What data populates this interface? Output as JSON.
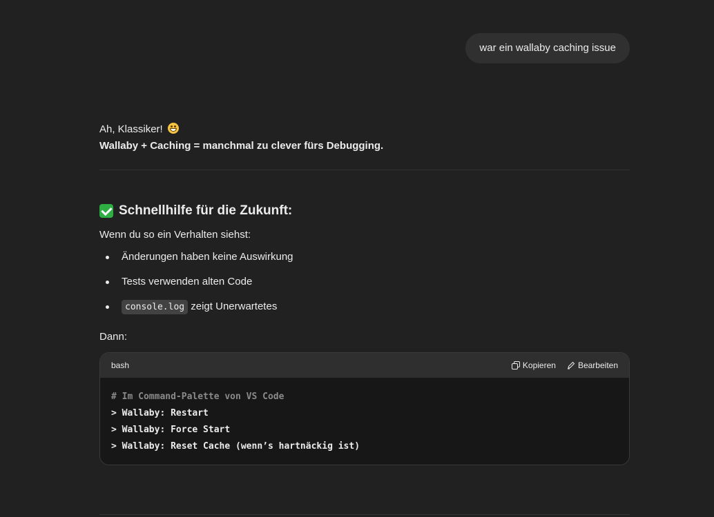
{
  "user_message": "war ein wallaby caching issue",
  "assistant": {
    "greeting": "Ah, Klassiker!",
    "greeting_emoji": "grinning-face-icon",
    "tagline": "Wallaby + Caching = manchmal zu clever fürs Debugging.",
    "heading": "Schnellhilfe für die Zukunft:",
    "heading_icon": "check-mark-button-icon",
    "intro": "Wenn du so ein Verhalten siehst:",
    "bullets": {
      "b0": "Änderungen haben keine Auswirkung",
      "b1": "Tests verwenden alten Code",
      "b2_code": "console.log",
      "b2_text": " zeigt Unerwartetes"
    },
    "then": "Dann:",
    "code_block": {
      "language": "bash",
      "copy_label": "Kopieren",
      "edit_label": "Bearbeiten",
      "lines": {
        "l0": "# Im Command-Palette von VS Code",
        "l1": "> Wallaby: Restart",
        "l2": "> Wallaby: Force Start",
        "l3": "> Wallaby: Reset Cache (wenn’s hartnäckig ist)"
      }
    }
  },
  "colors": {
    "background": "#212121",
    "user_bubble": "#303030",
    "code_header": "#2f2f2f",
    "code_body": "#171717",
    "check_green": "#2fae44"
  }
}
